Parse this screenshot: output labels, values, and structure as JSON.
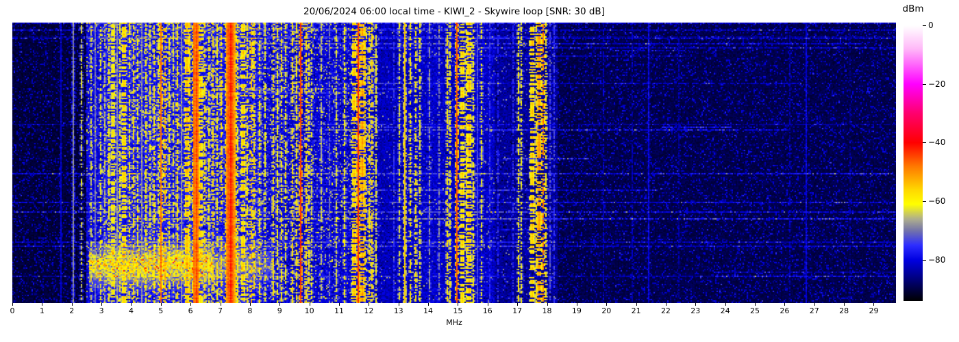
{
  "figure": {
    "background": "#ffffff"
  },
  "chart_data": {
    "type": "heatmap",
    "title": "20/06/2024 06:00 local time - KIWI_2 - Skywire loop [SNR: 30 dB]",
    "xlabel": "MHz",
    "x_ticks": [
      "0",
      "1",
      "2",
      "3",
      "4",
      "5",
      "6",
      "7",
      "8",
      "9",
      "10",
      "11",
      "12",
      "13",
      "14",
      "15",
      "16",
      "17",
      "18",
      "19",
      "20",
      "21",
      "22",
      "23",
      "24",
      "25",
      "26",
      "27",
      "28",
      "29"
    ],
    "xmax_mhz": 29.75,
    "grid": false,
    "colorbar": {
      "label": "dBm",
      "min": -94,
      "max": 0,
      "ticks": [
        {
          "v": 0,
          "label": "0"
        },
        {
          "v": -20,
          "label": "−20"
        },
        {
          "v": -40,
          "label": "−40"
        },
        {
          "v": -60,
          "label": "−60"
        },
        {
          "v": -80,
          "label": "−80"
        }
      ]
    },
    "colormap_stops": [
      [
        0,
        255,
        255,
        255
      ],
      [
        -8,
        255,
        185,
        248
      ],
      [
        -20,
        255,
        0,
        255
      ],
      [
        -30,
        255,
        0,
        110
      ],
      [
        -40,
        255,
        0,
        0
      ],
      [
        -48,
        255,
        120,
        0
      ],
      [
        -56,
        255,
        215,
        0
      ],
      [
        -61,
        255,
        255,
        0
      ],
      [
        -66,
        175,
        175,
        140
      ],
      [
        -70,
        115,
        115,
        170
      ],
      [
        -75,
        45,
        45,
        255
      ],
      [
        -80,
        0,
        0,
        225
      ],
      [
        -87,
        0,
        0,
        115
      ],
      [
        -94,
        0,
        0,
        0
      ]
    ],
    "background_regions_mhz_base_dbm": [
      {
        "f0": 0.0,
        "f1": 2.45,
        "base": -90.5,
        "activity": "low"
      },
      {
        "f0": 2.45,
        "f1": 3.0,
        "base": -80.0,
        "activity": "high"
      },
      {
        "f0": 3.0,
        "f1": 8.35,
        "base": -78.0,
        "activity": "high"
      },
      {
        "f0": 8.35,
        "f1": 9.35,
        "base": -80.0,
        "activity": "high"
      },
      {
        "f0": 9.35,
        "f1": 12.15,
        "base": -80.5,
        "activity": "high"
      },
      {
        "f0": 12.15,
        "f1": 13.1,
        "base": -82.5,
        "activity": "med"
      },
      {
        "f0": 13.1,
        "f1": 16.2,
        "base": -81.5,
        "activity": "med"
      },
      {
        "f0": 16.2,
        "f1": 18.35,
        "base": -84.5,
        "activity": "med"
      },
      {
        "f0": 18.35,
        "f1": 29.75,
        "base": -89.5,
        "activity": "low"
      }
    ],
    "carriers_f_level_w_intermittent": [
      [
        1.62,
        -80,
        1,
        0
      ],
      [
        2.05,
        -67,
        1,
        0
      ],
      [
        2.32,
        -62,
        1,
        1
      ],
      [
        2.62,
        -62,
        1,
        1
      ],
      [
        2.78,
        -69,
        1,
        0
      ],
      [
        2.95,
        -60,
        1,
        1
      ],
      [
        3.08,
        -64,
        1,
        1
      ],
      [
        3.22,
        -59,
        1,
        1
      ],
      [
        3.35,
        -57,
        2,
        1
      ],
      [
        3.5,
        -67,
        1,
        0
      ],
      [
        3.62,
        -59,
        1,
        1
      ],
      [
        3.75,
        -54,
        2,
        1
      ],
      [
        3.9,
        -58,
        1,
        1
      ],
      [
        4.05,
        -56,
        1,
        1
      ],
      [
        4.2,
        -60,
        1,
        1
      ],
      [
        4.33,
        -67,
        1,
        0
      ],
      [
        4.47,
        -58,
        1,
        1
      ],
      [
        4.62,
        -60,
        1,
        1
      ],
      [
        4.77,
        -57,
        1,
        1
      ],
      [
        4.9,
        -62,
        1,
        1
      ],
      [
        5.0,
        -46,
        1,
        0
      ],
      [
        5.1,
        -52,
        1,
        1
      ],
      [
        5.25,
        -57,
        1,
        1
      ],
      [
        5.4,
        -60,
        1,
        1
      ],
      [
        5.55,
        -56,
        1,
        1
      ],
      [
        5.68,
        -66,
        1,
        0
      ],
      [
        5.85,
        -52,
        2,
        1
      ],
      [
        5.96,
        -55,
        1,
        1
      ],
      [
        6.07,
        -46,
        1,
        0
      ],
      [
        6.18,
        -43,
        2,
        0
      ],
      [
        6.3,
        -54,
        2,
        1
      ],
      [
        6.45,
        -56,
        1,
        1
      ],
      [
        6.6,
        -58,
        1,
        1
      ],
      [
        6.75,
        -55,
        1,
        1
      ],
      [
        6.88,
        -58,
        1,
        1
      ],
      [
        7.0,
        -56,
        1,
        1
      ],
      [
        7.22,
        -45,
        2,
        0
      ],
      [
        7.32,
        -40,
        3,
        0
      ],
      [
        7.44,
        -48,
        2,
        0
      ],
      [
        7.58,
        -57,
        1,
        1
      ],
      [
        7.74,
        -54,
        2,
        1
      ],
      [
        7.9,
        -56,
        1,
        1
      ],
      [
        8.02,
        -52,
        1,
        1
      ],
      [
        8.12,
        -55,
        1,
        1
      ],
      [
        8.3,
        -58,
        1,
        1
      ],
      [
        8.47,
        -60,
        1,
        1
      ],
      [
        8.75,
        -56,
        1,
        1
      ],
      [
        8.92,
        -59,
        1,
        1
      ],
      [
        9.06,
        -57,
        1,
        1
      ],
      [
        9.17,
        -59,
        1,
        1
      ],
      [
        9.42,
        -55,
        1,
        1
      ],
      [
        9.53,
        -57,
        1,
        1
      ],
      [
        9.7,
        -42,
        1,
        0
      ],
      [
        9.85,
        -55,
        1,
        1
      ],
      [
        9.96,
        -57,
        1,
        1
      ],
      [
        10.05,
        -61,
        1,
        1
      ],
      [
        10.4,
        -63,
        1,
        1
      ],
      [
        10.67,
        -69,
        1,
        1
      ],
      [
        10.9,
        -62,
        1,
        1
      ],
      [
        11.16,
        -59,
        1,
        1
      ],
      [
        11.5,
        -53,
        2,
        1
      ],
      [
        11.62,
        -42,
        1,
        0
      ],
      [
        11.75,
        -49,
        2,
        1
      ],
      [
        11.87,
        -54,
        1,
        1
      ],
      [
        11.97,
        -56,
        1,
        1
      ],
      [
        12.07,
        -55,
        1,
        1
      ],
      [
        12.22,
        -60,
        1,
        1
      ],
      [
        12.82,
        -74,
        1,
        1
      ],
      [
        13.0,
        -62,
        1,
        1
      ],
      [
        13.2,
        -54,
        1,
        0
      ],
      [
        13.38,
        -57,
        1,
        1
      ],
      [
        13.58,
        -56,
        1,
        1
      ],
      [
        13.72,
        -60,
        1,
        1
      ],
      [
        14.0,
        -66,
        1,
        1
      ],
      [
        14.35,
        -68,
        1,
        1
      ],
      [
        14.6,
        -56,
        1,
        1
      ],
      [
        14.72,
        -59,
        1,
        1
      ],
      [
        14.95,
        -44,
        1,
        0
      ],
      [
        15.12,
        -54,
        2,
        1
      ],
      [
        15.28,
        -56,
        1,
        1
      ],
      [
        15.38,
        -53,
        2,
        1
      ],
      [
        15.48,
        -58,
        1,
        1
      ],
      [
        15.62,
        -72,
        1,
        0
      ],
      [
        15.78,
        -60,
        1,
        1
      ],
      [
        16.05,
        -74,
        1,
        1
      ],
      [
        16.35,
        -75,
        1,
        1
      ],
      [
        16.85,
        -74,
        1,
        1
      ],
      [
        17.02,
        -58,
        1,
        1
      ],
      [
        17.12,
        -60,
        1,
        1
      ],
      [
        17.5,
        -53,
        2,
        1
      ],
      [
        17.62,
        -56,
        1,
        1
      ],
      [
        17.72,
        -49,
        2,
        1
      ],
      [
        17.85,
        -47,
        1,
        1
      ],
      [
        17.95,
        -58,
        1,
        1
      ],
      [
        18.1,
        -71,
        1,
        1
      ],
      [
        18.22,
        -73,
        1,
        1
      ],
      [
        19.9,
        -81,
        1,
        1
      ],
      [
        20.85,
        -82,
        1,
        1
      ],
      [
        21.4,
        -78,
        1,
        0
      ],
      [
        22.4,
        -83,
        1,
        1
      ],
      [
        26.15,
        -82,
        1,
        1
      ],
      [
        26.7,
        -79,
        1,
        0
      ],
      [
        28.2,
        -84,
        1,
        1
      ]
    ],
    "broadband_row_streaks": {
      "count": 30,
      "min_boost": 4,
      "max_boost": 11
    },
    "bottom_noise_blob": {
      "f0": 2.55,
      "f1": 6.7,
      "f1_weak": 8.8,
      "row_center": 177,
      "row_sigma": 9,
      "boost": 19
    }
  }
}
